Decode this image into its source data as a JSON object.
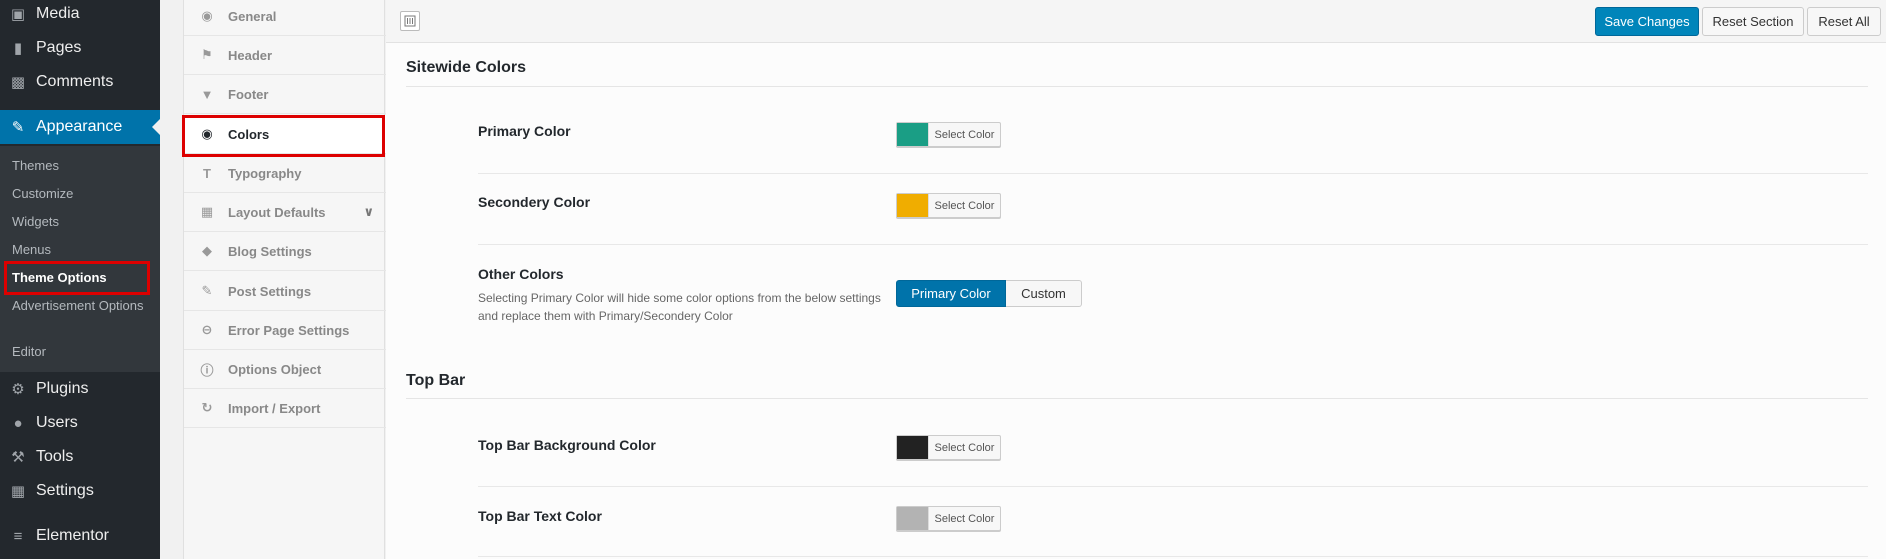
{
  "wp_menu": {
    "items": [
      {
        "label": "Media",
        "icon": "media-icon"
      },
      {
        "label": "Pages",
        "icon": "pages-icon"
      },
      {
        "label": "Comments",
        "icon": "comments-icon"
      },
      {
        "label": "Appearance",
        "icon": "paintbrush-icon"
      },
      {
        "label": "Plugins",
        "icon": "plugins-icon"
      },
      {
        "label": "Users",
        "icon": "users-icon"
      },
      {
        "label": "Tools",
        "icon": "tools-icon"
      },
      {
        "label": "Settings",
        "icon": "settings-icon"
      },
      {
        "label": "Elementor",
        "icon": "elementor-icon"
      }
    ],
    "submenu": [
      "Themes",
      "Customize",
      "Widgets",
      "Menus",
      "Theme Options",
      "Advertisement Options",
      "Editor"
    ]
  },
  "options_nav": {
    "items": [
      {
        "label": "General",
        "icon": "globe-icon"
      },
      {
        "label": "Header",
        "icon": "flag-icon"
      },
      {
        "label": "Footer",
        "icon": "triangle-down-icon"
      },
      {
        "label": "Colors",
        "icon": "eye-icon"
      },
      {
        "label": "Typography",
        "icon": "text-icon"
      },
      {
        "label": "Layout Defaults",
        "icon": "grid-icon"
      },
      {
        "label": "Blog Settings",
        "icon": "tag-icon"
      },
      {
        "label": "Post Settings",
        "icon": "edit-icon"
      },
      {
        "label": "Error Page Settings",
        "icon": "minus-circle-icon"
      },
      {
        "label": "Options Object",
        "icon": "info-icon"
      },
      {
        "label": "Import / Export",
        "icon": "refresh-icon"
      }
    ]
  },
  "toolbar": {
    "save_label": "Save Changes",
    "reset_section_label": "Reset Section",
    "reset_all_label": "Reset All"
  },
  "sections": {
    "sitewide": {
      "title": "Sitewide Colors",
      "primary_label": "Primary Color",
      "primary_color": "#1a9e85",
      "secondary_label": "Secondery Color",
      "secondary_color": "#f0ad00",
      "other_label": "Other Colors",
      "other_desc": "Selecting Primary Color will hide some color options from the below settings and replace them with Primary/Secondery Color",
      "other_option_primary": "Primary Color",
      "other_option_custom": "Custom"
    },
    "topbar": {
      "title": "Top Bar",
      "bg_label": "Top Bar Background Color",
      "bg_color": "#222222",
      "text_label": "Top Bar Text Color",
      "text_color": "#b3b3b3"
    },
    "select_color_label": "Select Color"
  },
  "colors": {
    "wp_sidebar": "#23282d",
    "accent": "#0073aa",
    "highlight_box": "#dd0000"
  }
}
